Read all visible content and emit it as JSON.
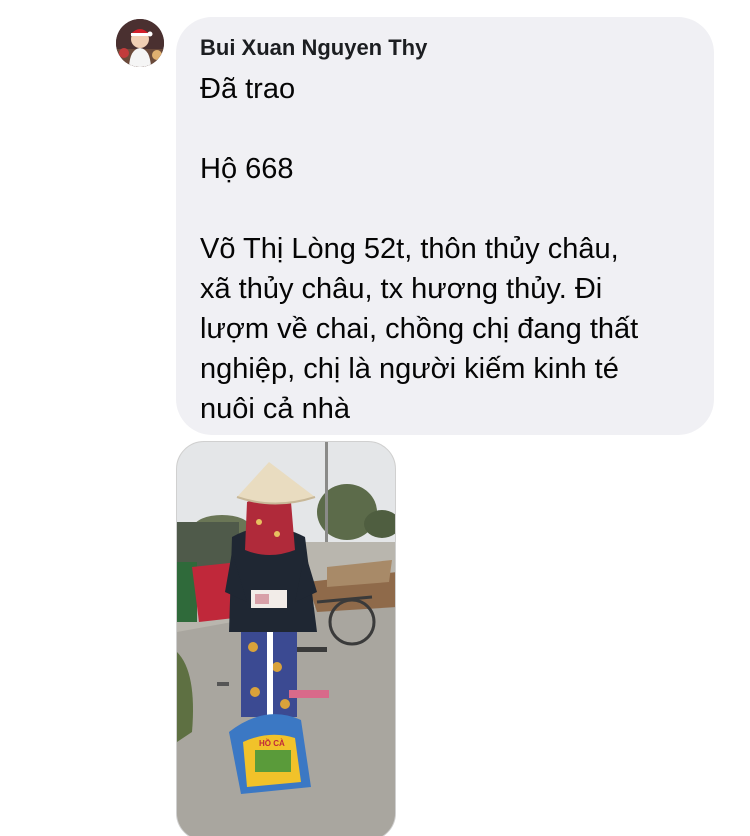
{
  "message": {
    "sender_name": "Bui Xuan Nguyen Thy",
    "lines": [
      "Đã trao",
      "",
      "Hộ 668",
      "",
      "Võ Thị Lòng 52t, thôn thủy châu,",
      "xã thủy châu, tx hương thủy. Đi",
      "lượm về chai, chồng chị đang thất",
      "nghiệp, chị là người kiếm kinh té",
      "nuôi cả nhà"
    ]
  },
  "photo": {
    "rice_bag_label": "HỒ CÀ"
  },
  "colors": {
    "bubble_bg": "#f0f0f4",
    "text": "#050505",
    "sender_text": "#1c1e21"
  }
}
